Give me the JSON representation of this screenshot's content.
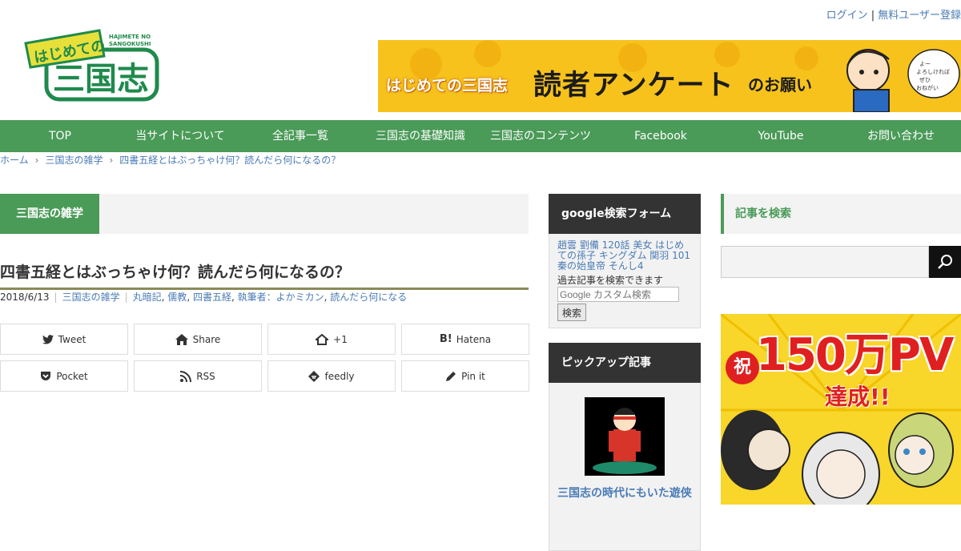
{
  "header": {
    "login": "ログイン",
    "separator": "|",
    "register": "無料ユーザー登録",
    "logo_roman": "HAJIMETE NO SANGOKUSHI",
    "logo_small": "はじめての",
    "logo_main": "三国志",
    "banner": {
      "prefix": "はじめての三国志",
      "main": "読者アンケート",
      "suffix": "のお願い",
      "bubble": "よーよろしければぜひおねがいしますー"
    }
  },
  "nav": {
    "items": [
      "TOP",
      "当サイトについて",
      "全記事一覧",
      "三国志の基礎知識",
      "三国志のコンテンツ",
      "Facebook",
      "YouTube",
      "お問い合わせ"
    ]
  },
  "breadcrumb": {
    "home": "ホーム",
    "category": "三国志の雑学",
    "current": "四書五経とはぶっちゃけ何？読んだら何になるの？"
  },
  "article": {
    "category": "三国志の雑学",
    "title": "四書五経とはぶっちゃけ何？読んだら何になるの？",
    "date": "2018/6/13",
    "meta_category": "三国志の雑学",
    "tags": [
      "丸暗記",
      "儒教",
      "四書五経",
      "執筆者：よかミカン",
      "読んだら何になる"
    ]
  },
  "share": {
    "buttons": [
      {
        "label": "Tweet",
        "icon": "twitter-icon"
      },
      {
        "label": "Share",
        "icon": "share-home-icon"
      },
      {
        "label": "+1",
        "icon": "plus-home-icon"
      },
      {
        "label": "Hatena",
        "icon": "hatena-icon"
      },
      {
        "label": "Pocket",
        "icon": "pocket-icon"
      },
      {
        "label": "RSS",
        "icon": "rss-icon"
      },
      {
        "label": "feedly",
        "icon": "feedly-icon"
      },
      {
        "label": "Pin it",
        "icon": "pencil-icon"
      }
    ]
  },
  "sidebar": {
    "google": {
      "heading": "google検索フォーム",
      "keywords": "趙雲 劉備 120話 美女 はじめての孫子 キングダム 関羽 101 秦の始皇帝 そんし4",
      "note": "過去記事を検索できます",
      "placeholder": "Google カスタム検索",
      "button": "検索"
    },
    "pickup": {
      "heading": "ピックアップ記事",
      "title": "三国志の時代にもいた遊侠"
    },
    "search": {
      "heading": "記事を検索"
    },
    "pv_banner": {
      "iwai": "祝",
      "text": "150万PV",
      "sub": "達成!!"
    }
  },
  "colors": {
    "green": "#4a9a58",
    "link": "#4a7bb5",
    "banner_yellow": "#f7c21c"
  }
}
